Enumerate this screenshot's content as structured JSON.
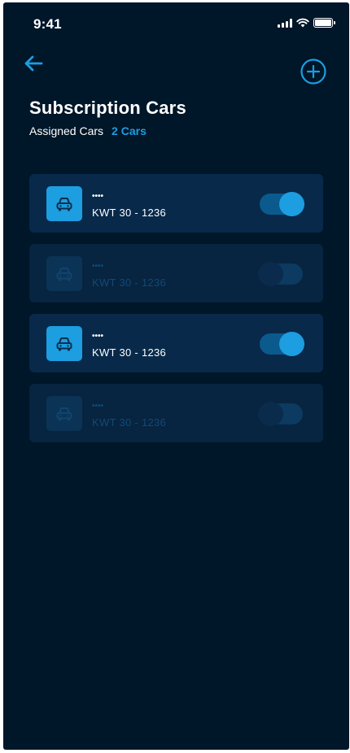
{
  "status_bar": {
    "time": "9:41"
  },
  "header": {
    "title": "Subscription Cars",
    "assigned_label": "Assigned Cars",
    "assigned_count": "2 Cars"
  },
  "colors": {
    "background": "#001629",
    "card": "#08294a",
    "accent": "#1c9ee0",
    "text": "#ffffff"
  },
  "icons": {
    "back": "arrow-left-icon",
    "add": "plus-circle-icon",
    "car": "car-icon"
  },
  "cars": [
    {
      "name": "••••",
      "plate": "KWT  30 - 1236",
      "enabled": true
    },
    {
      "name": "••••",
      "plate": "KWT  30 - 1236",
      "enabled": false
    },
    {
      "name": "••••",
      "plate": "KWT  30 - 1236",
      "enabled": true
    },
    {
      "name": "••••",
      "plate": "KWT  30 - 1236",
      "enabled": false
    }
  ]
}
